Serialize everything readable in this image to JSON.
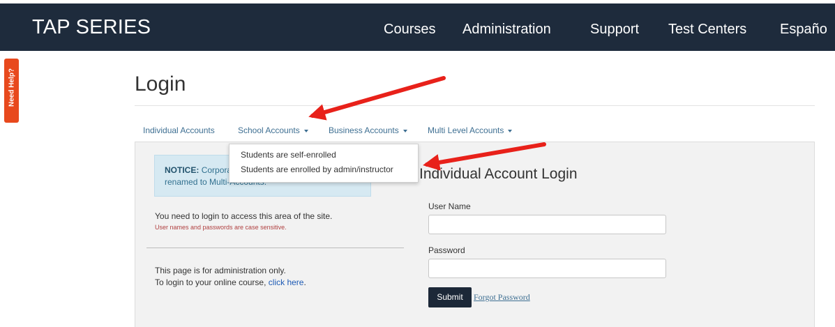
{
  "header": {
    "brand": "TAP SERIES",
    "nav": [
      "Courses",
      "Administration",
      "Support",
      "Test Centers",
      "Españo"
    ]
  },
  "help_tab": "Need Help?",
  "page_title": "Login",
  "tabs": [
    "Individual Accounts",
    "School Accounts",
    "Business Accounts",
    "Multi Level Accounts"
  ],
  "dropdown": {
    "items": [
      "Students are self-enrolled",
      "Students are enrolled by admin/instructor"
    ]
  },
  "notice": {
    "label": "NOTICE:",
    "line1": "Corpora",
    "line2": "renamed to Multi-Accounts."
  },
  "left": {
    "login_required": "You need to login to access this area of the site.",
    "case_note": "User names and passwords are case sensitive.",
    "admin_only": "This page is for administration only.",
    "course_prefix": "To login to your online course,",
    "click_here": "click here",
    "course_suffix": "."
  },
  "form": {
    "title": "Individual Account Login",
    "username_label": "User Name",
    "password_label": "Password",
    "submit": "Submit",
    "forgot": "Forgot Password"
  },
  "colors": {
    "header_bg": "#1e2b3c",
    "help_tab": "#e8491d",
    "annotation_arrow": "#e8211a",
    "link": "#3e6f92"
  }
}
